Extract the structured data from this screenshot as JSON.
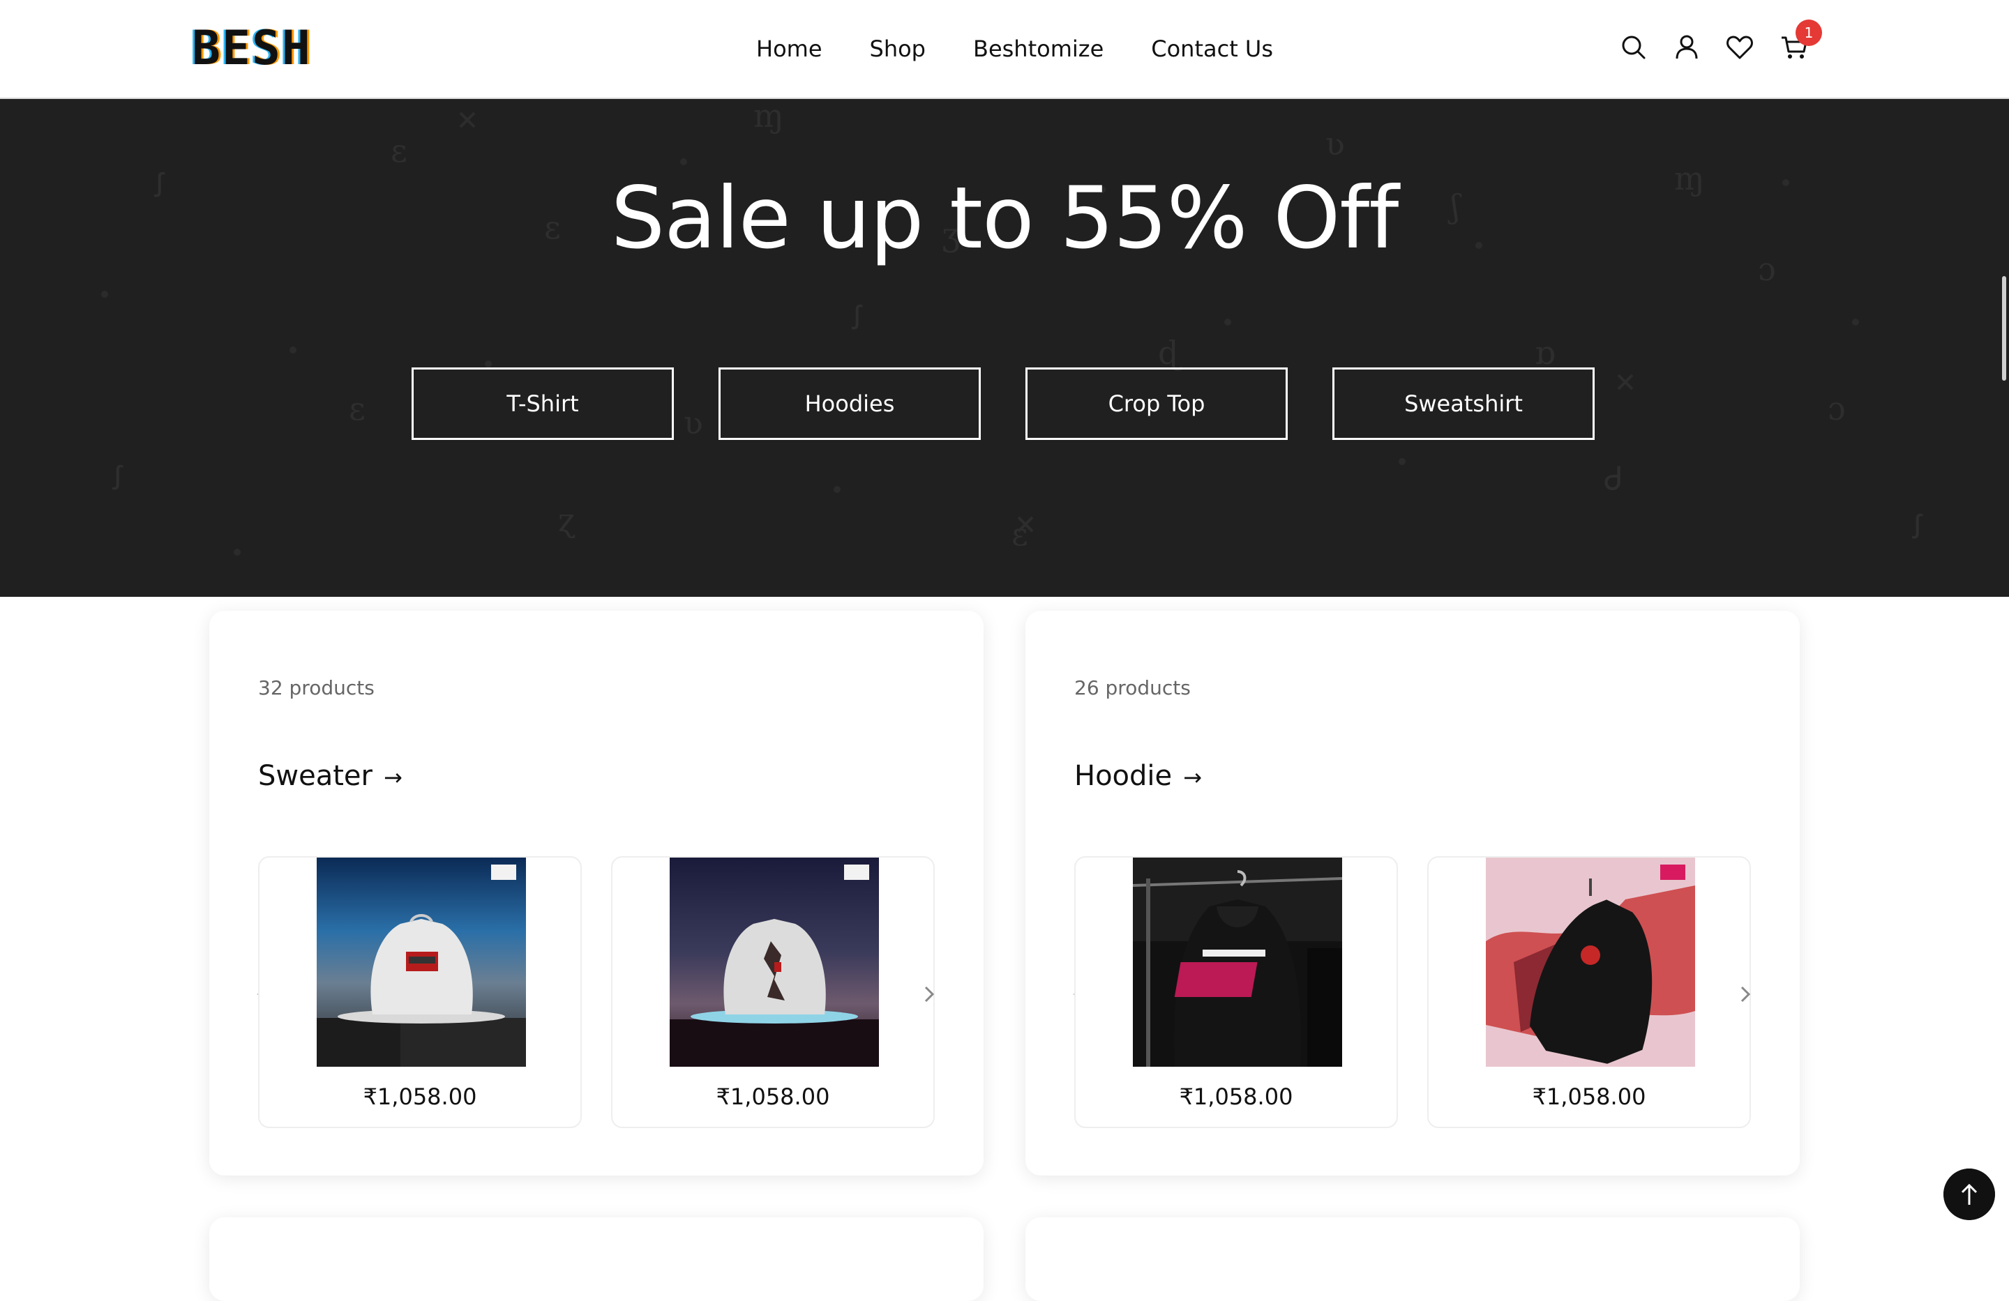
{
  "header": {
    "logo_text": "BESH",
    "nav": [
      "Home",
      "Shop",
      "Beshtomize",
      "Contact Us"
    ],
    "icons": [
      "search-icon",
      "user-icon",
      "heart-icon",
      "cart-icon"
    ],
    "cart_count": "1"
  },
  "hero": {
    "title": "Sale up to 55% Off",
    "categories": [
      "T-Shirt",
      "Hoodies",
      "Crop Top",
      "Sweatshirt"
    ]
  },
  "collections": [
    {
      "count": "32 products",
      "title": "Sweater",
      "products": [
        {
          "price": "₹1,058.00"
        },
        {
          "price": "₹1,058.00"
        }
      ]
    },
    {
      "count": "26 products",
      "title": "Hoodie",
      "products": [
        {
          "price": "₹1,058.00"
        },
        {
          "price": "₹1,058.00"
        }
      ]
    }
  ],
  "colors": {
    "hero_bg": "#202020",
    "badge": "#e53935",
    "text": "#111111"
  }
}
